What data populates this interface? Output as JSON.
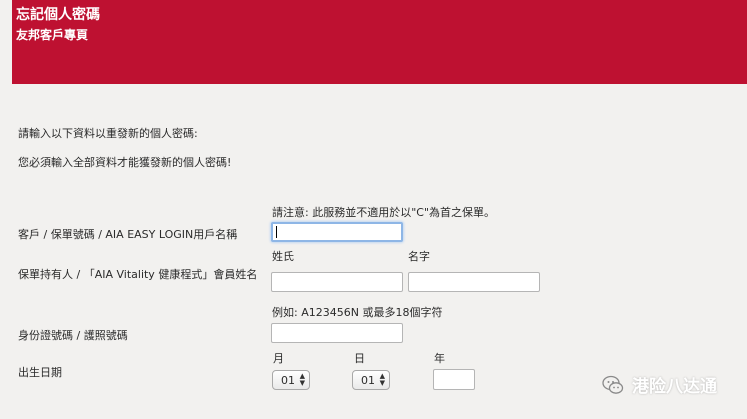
{
  "header": {
    "title": "忘記個人密碼",
    "subtitle": "友邦客戶專頁",
    "color": "#be1131"
  },
  "intro": {
    "line1": "請輸入以下資料以重發新的個人密碼:",
    "line2": "您必須輸入全部資料才能獲發新的個人密碼!"
  },
  "policy": {
    "note": "請注意: 此服務並不適用於以\"C\"為首之保單。",
    "label": "客戶 / 保單號碼 / AIA EASY LOGIN用戶名稱",
    "value": ""
  },
  "holder": {
    "surname_label": "姓氏",
    "given_label": "名字",
    "label": "保單持有人 / 「AIA Vitality 健康程式」會員姓名",
    "surname_value": "",
    "given_value": ""
  },
  "id_doc": {
    "example": "例如: A123456N 或最多18個字符",
    "label": "身份證號碼 / 護照號碼",
    "value": ""
  },
  "dob": {
    "month_label": "月",
    "day_label": "日",
    "year_label": "年",
    "label": "出生日期",
    "month_value": "01",
    "day_value": "01",
    "year_value": ""
  },
  "watermark": {
    "text": "港险八达通",
    "icon": "wechat-icon"
  }
}
